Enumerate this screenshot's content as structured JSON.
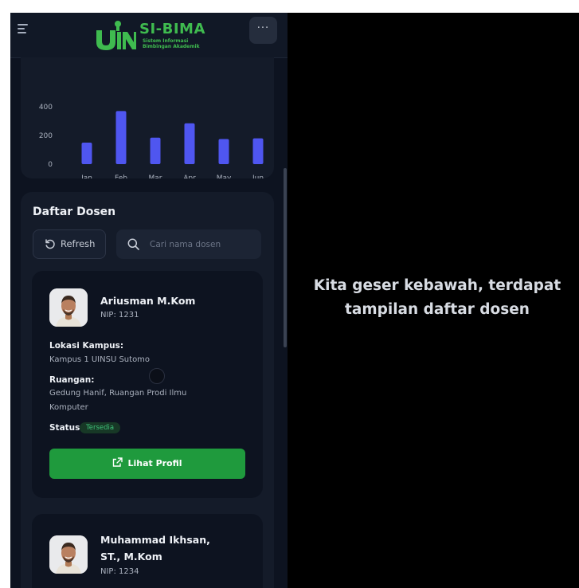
{
  "app": {
    "logo_title": "SI-BIMA",
    "logo_subtitle_line1": "Sistem Informasi",
    "logo_subtitle_line2": "Bimbingan Akademik",
    "more_label": "···"
  },
  "chart_data": {
    "type": "bar",
    "categories": [
      "Jan",
      "Feb",
      "Mar",
      "Apr",
      "May",
      "Jun"
    ],
    "values": [
      150,
      370,
      185,
      285,
      175,
      180
    ],
    "yticks": [
      0,
      200,
      400
    ],
    "ylim": [
      0,
      400
    ],
    "bar_color": "#4f56f0",
    "title": "",
    "xlabel": "",
    "ylabel": ""
  },
  "dosen": {
    "section_title": "Daftar Dosen",
    "refresh_label": "Refresh",
    "search_placeholder": "Cari nama dosen",
    "lecturers": [
      {
        "name": "Ariusman M.Kom",
        "nip": "NIP: 1231",
        "lokasi_label": "Lokasi Kampus:",
        "lokasi": "Kampus 1 UINSU Sutomo",
        "ruangan_label": "Ruangan:",
        "ruangan": "Gedung Hanif, Ruangan Prodi Ilmu Komputer",
        "status_label": "Status",
        "status": "Tersedia",
        "button_label": "Lihat Profil"
      },
      {
        "name": "Muhammad Ikhsan, ST., M.Kom",
        "nip": "NIP: 1234"
      }
    ]
  },
  "caption": "Kita geser kebawah, terdapat tampilan daftar dosen",
  "colors": {
    "background": "#0d1320",
    "card": "#141b29",
    "accent_green": "#1f9a3d",
    "bar_blue": "#4f56f0",
    "badge_green": "#3ec27a"
  }
}
